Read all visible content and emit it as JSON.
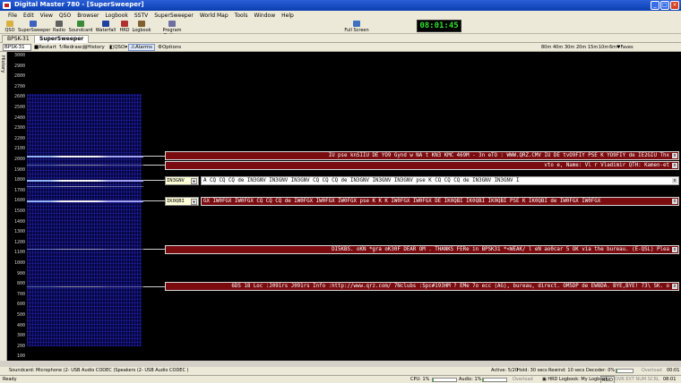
{
  "window": {
    "title": "Digital Master 780 - [SuperSweeper]"
  },
  "menu": [
    "File",
    "Edit",
    "View",
    "QSO",
    "Browser",
    "Logbook",
    "SSTV",
    "SuperSweeper",
    "World Map",
    "Tools",
    "Window",
    "Help"
  ],
  "toolbar": {
    "buttons": [
      "QSO",
      "SuperSweeper",
      "Radio",
      "Soundcard",
      "Waterfall",
      "HRD",
      "Logbook",
      "Program Options"
    ],
    "fullscreen": "Full Screen",
    "clock": "08:01:45"
  },
  "tabs": [
    "BPSK-31",
    "SuperSweeper"
  ],
  "subbar": {
    "mode": "BPSK-31",
    "items": [
      "Restart",
      "Redraw",
      "History",
      "QSO",
      "Alarms",
      "Options"
    ],
    "zoom": [
      "80m",
      "40m",
      "30m",
      "20m",
      "15m",
      "10m",
      "6m"
    ],
    "faves": "Faves"
  },
  "side_tab": "History",
  "axis_ticks": [
    "3000",
    "2900",
    "2800",
    "2700",
    "2600",
    "2500",
    "2400",
    "2300",
    "2200",
    "2100",
    "2000",
    "1900",
    "1800",
    "1700",
    "1600",
    "1500",
    "1400",
    "1300",
    "1200",
    "1100",
    "1000",
    "900",
    "800",
    "700",
    "600",
    "500",
    "400",
    "300",
    "200",
    "100"
  ],
  "messages": [
    {
      "text": "IU pse knSIIU DE YO9 Gynd w NA t KN3 KMC 469M - 3n eTO : WWW.QRZ.CMV IU DE tvO9FIY PSE K YO9FIY de IE2GIU Thx"
    },
    {
      "text": "vto e, Name: Vl r Vladimir QTH: Kamen-et"
    },
    {
      "call": "IN3GNV",
      "text": "A CQ CQ CQ de IN3GNV IN3GNV IN3GNV CQ CQ CQ de IN3GNV IN3GNV IN3GNV pse K CQ CQ CQ de IN3GNV IN3GNV I"
    },
    {
      "call": "IK0QBI",
      "text": "GX IW0FGX IW0FGX CQ CQ CQ de IW0FGX IW0FGX IW0FGX pse K K K IW0FGX IW0FGX DE IK0QBI IK0QBI IK0QBI PSE K IK0QBI de IW0FGX IW0FGX"
    },
    {
      "text": "DI5KBS. oKN *gra oK30F DEAR OM . THANKS FERe in BPSK31 *<WEAK/ l eN ao0car 5 OK via the bureau. (E-QSL) Plea"
    },
    {
      "text": "6DS 18 Loc :J091rs J091rs Info :http://www.qrz.com/ 7Nclubs :Spc#193HM ? EMe 7o ecc (AG), bureau, direct. OM5DP de EW8DA. BYE,BYE! 73\\ SK. o"
    }
  ],
  "status": {
    "soundcard": "Soundcard: Microphone (2- USB Audio CODEC )Speakers (2- USB Audio CODEC )",
    "active": "Active: 5/20",
    "hold": "Hold: 30 secs",
    "rewind": "Rewind: 10 secs",
    "decoder": "Decoder: 0%",
    "overload": "Overload",
    "counter": "00:01",
    "ready": "Ready",
    "cpu": "CPU: 1%",
    "audio": "Audio: 1%",
    "overload2": "Overload",
    "hrd_logbook": "HRD Logbook: My Logbook",
    "rsid": "RSID",
    "flags": "OVR EXT NUM SCRL",
    "time": "08:01"
  },
  "colors": {
    "message_bg": "#7a0c10",
    "clock_fg": "#2ee02e",
    "titlebar": "#0a3fb0"
  }
}
